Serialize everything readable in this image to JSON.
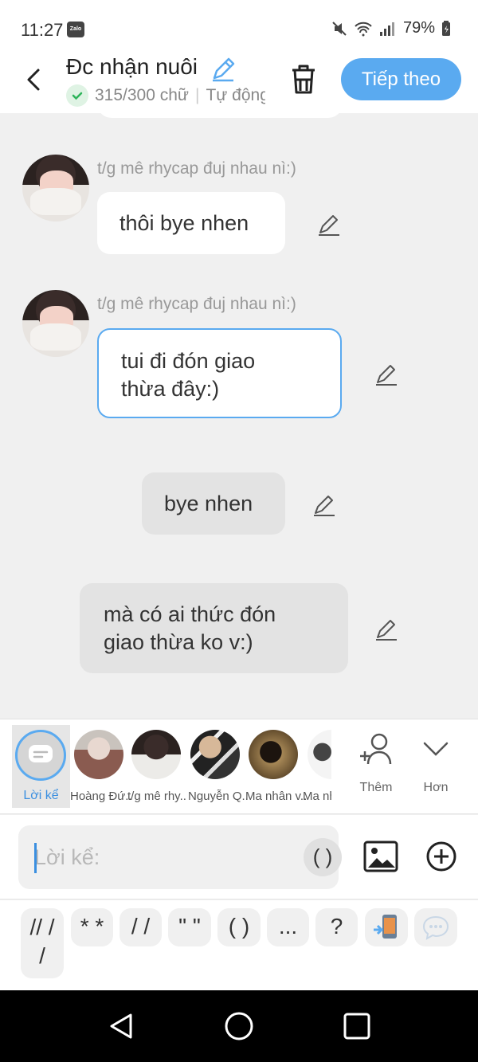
{
  "status_bar": {
    "time": "11:27",
    "app_badge": "Zalo",
    "battery": "79%"
  },
  "header": {
    "title": "Đc nhận nuôi",
    "char_count": "315/300 chữ",
    "mode": "Tự động",
    "next_label": "Tiếp theo"
  },
  "messages": [
    {
      "sender": "t/g mê rhycap đuj nhau nì:)",
      "text": "thôi bye nhen"
    },
    {
      "sender": "t/g mê rhycap đuj nhau nì:)",
      "text_line1": "tui đi đón giao",
      "text_line2": "thừa đây:)"
    },
    {
      "text": "bye nhen"
    },
    {
      "text_line1": "mà có ai thức đón",
      "text_line2": "giao thừa ko v:)"
    }
  ],
  "characters": {
    "narrator_label": "Lời kể",
    "names": [
      "Hoàng Đứ..",
      "t/g mê rhy..",
      "Nguyễn Q..",
      "Ma nhân v..",
      "Ma nh"
    ],
    "add_label": "Thêm",
    "more_label": "Hơn"
  },
  "composer": {
    "placeholder": "Lời kể:",
    "paren_label": "( )"
  },
  "shortcut_keys": [
    "// /",
    "/",
    "* *",
    "/ /",
    "\" \"",
    "( )",
    "...",
    "?"
  ],
  "icons": [
    "back-arrow-icon",
    "pencil-icon",
    "check-icon",
    "trash-icon",
    "image-icon",
    "plus-circle-icon",
    "add-person-icon",
    "chevron-down-icon",
    "phone-icon",
    "chat-bubble-icon",
    "nav-back-icon",
    "nav-home-icon",
    "nav-recents-icon"
  ],
  "colors": {
    "accent": "#5aaaf0",
    "background": "#f0f0f0",
    "narrator_label": "#3b8fe0"
  }
}
